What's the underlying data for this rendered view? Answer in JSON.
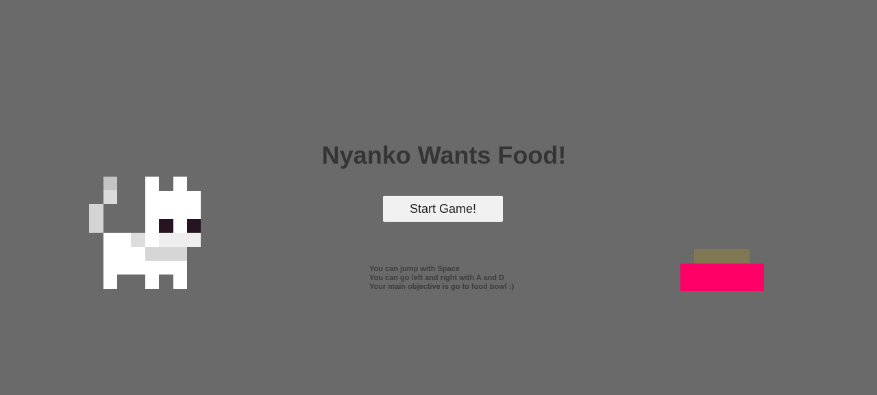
{
  "game": {
    "title": "Nyanko Wants Food!",
    "start_button_label": "Start Game!",
    "instructions": [
      "You can jump with Space",
      "You can go left and right with A and D",
      "Your main objective is go to food bowl :)"
    ]
  },
  "colors": {
    "background": "#6a6a6a",
    "title_text": "#353535",
    "button_bg": "#f1f1f1",
    "cat_body": "#ffffff",
    "cat_shade": "#d6d6d6",
    "cat_eye": "#261422",
    "bowl": "#ff0066",
    "food": "#807753"
  },
  "sprites": {
    "player": "cat-sprite",
    "goal": "food-bowl-sprite"
  }
}
